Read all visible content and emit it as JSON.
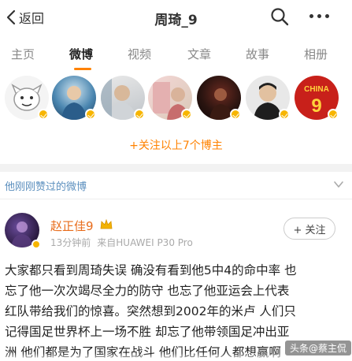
{
  "header": {
    "back_label": "返回",
    "title": "周琦_9"
  },
  "tabs": [
    {
      "label": "主页",
      "active": false
    },
    {
      "label": "微博",
      "active": true
    },
    {
      "label": "视频",
      "active": false
    },
    {
      "label": "文章",
      "active": false
    },
    {
      "label": "故事",
      "active": false
    },
    {
      "label": "相册",
      "active": false
    }
  ],
  "recommended": {
    "avatars": [
      {
        "icon": "cartoon-avatar"
      },
      {
        "icon": "player-avatar"
      },
      {
        "icon": "person-avatar"
      },
      {
        "icon": "sports-avatar"
      },
      {
        "icon": "dark-avatar"
      },
      {
        "icon": "man-avatar"
      },
      {
        "icon": "china-9-jersey-avatar",
        "jersey_text": "CHINA",
        "jersey_number": "9"
      }
    ],
    "follow_all_label": "+关注以上7个博主"
  },
  "liked_section": {
    "header": "他刚刚赞过的微博"
  },
  "post": {
    "author": "赵正佳9",
    "time": "13分钟前",
    "source": "来自HUAWEI P30 Pro",
    "follow_label": "+ 关注",
    "lines": [
      "大家都只看到周琦失误 确没有看到他5中4的命中率 也",
      "忘了他一次次竭尽全力的防守 也忘了他亚运会上代表",
      "红队带给我们的惊喜。突然想到2002年的米卢 人们只",
      "记得国足世界杯上一场不胜 却忘了他带领国足冲出亚",
      "洲 他们都是为了国家在战斗 他们比任何人都想赢啊"
    ]
  },
  "watermark": "头条@蔡主侃",
  "colors": {
    "accent": "#ff8200",
    "link": "#5b8fbe",
    "author": "#e86c1b",
    "badge": "#f7b500"
  }
}
